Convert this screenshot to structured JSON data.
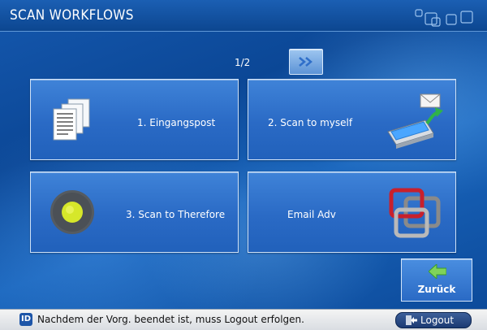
{
  "header": {
    "title": "SCAN WORKFLOWS"
  },
  "pager": {
    "indicator": "1/2"
  },
  "tiles": [
    {
      "label": "1. Eingangspost"
    },
    {
      "label": "2. Scan to myself"
    },
    {
      "label": "3. Scan to Therefore"
    },
    {
      "label": "Email Adv"
    }
  ],
  "back": {
    "label": "Zurück"
  },
  "status": {
    "badge": "ID",
    "message": "Nachdem der Vorg. beendet ist, muss Logout erfolgen.",
    "logout_label": "Logout"
  },
  "colors": {
    "accent": "#2a6ac5",
    "header": "#0c4690",
    "statusbar": "#e6e8eb"
  }
}
